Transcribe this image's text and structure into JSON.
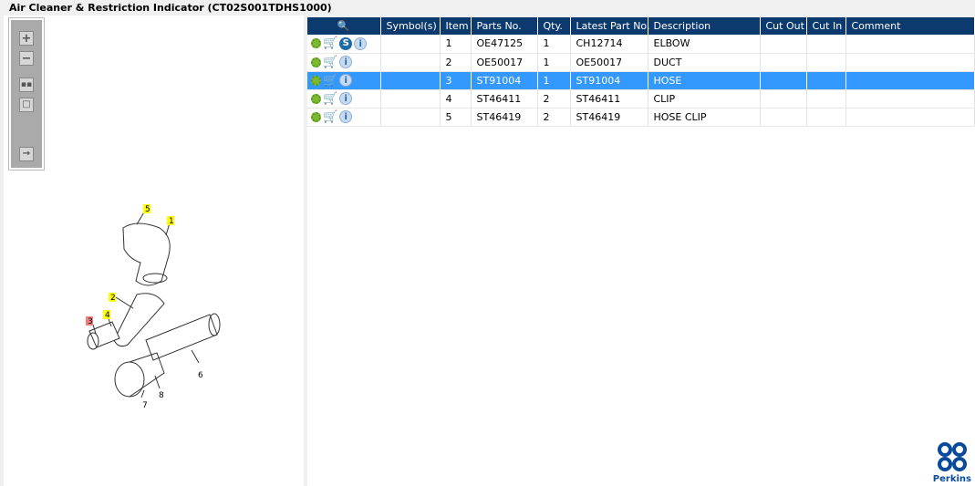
{
  "title": "Air Cleaner & Restriction Indicator (CT02S001TDHS1000)",
  "toolbar": {
    "zoom_in": "+",
    "zoom_out": "−"
  },
  "drawing": {
    "callouts": [
      "1",
      "2",
      "3",
      "4",
      "5",
      "6",
      "7",
      "8"
    ],
    "highlighted": [
      "1",
      "2",
      "4",
      "5"
    ],
    "selected": "3"
  },
  "table": {
    "headers": [
      "Symbol(s)",
      "Item",
      "Parts No.",
      "Qty.",
      "Latest Part No.",
      "Description",
      "Cut Out",
      "Cut In",
      "Comment"
    ],
    "rows": [
      {
        "symbols": "",
        "item": "1",
        "part": "OE47125",
        "qty": "1",
        "latest": "CH12714",
        "desc": "ELBOW",
        "cutout": "",
        "cutin": "",
        "comment": "",
        "s_icon": "S",
        "info": "i"
      },
      {
        "symbols": "",
        "item": "2",
        "part": "OE50017",
        "qty": "1",
        "latest": "OE50017",
        "desc": "DUCT",
        "cutout": "",
        "cutin": "",
        "comment": "",
        "info": "i"
      },
      {
        "symbols": "",
        "item": "3",
        "part": "ST91004",
        "qty": "1",
        "latest": "ST91004",
        "desc": "HOSE",
        "cutout": "",
        "cutin": "",
        "comment": "",
        "info": "i"
      },
      {
        "symbols": "",
        "item": "4",
        "part": "ST46411",
        "qty": "2",
        "latest": "ST46411",
        "desc": "CLIP",
        "cutout": "",
        "cutin": "",
        "comment": "",
        "info": "i"
      },
      {
        "symbols": "",
        "item": "5",
        "part": "ST46419",
        "qty": "2",
        "latest": "ST46419",
        "desc": "HOSE CLIP",
        "cutout": "",
        "cutin": "",
        "comment": "",
        "info": "i"
      }
    ],
    "selected_row": 3
  },
  "logo": {
    "text": "Perkins"
  },
  "colors": {
    "header": "#0c3a6e",
    "selected": "#3399ff",
    "callout": "#ffff00",
    "callout_selected": "#f08080"
  }
}
